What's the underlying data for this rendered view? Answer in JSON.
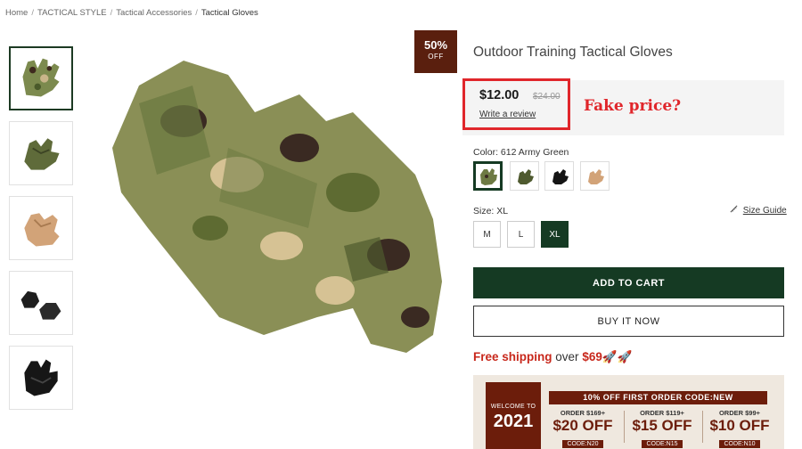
{
  "breadcrumb": [
    "Home",
    "TACTICAL STYLE",
    "Tactical Accessories",
    "Tactical Gloves"
  ],
  "breadcrumb_separator": "/",
  "product": {
    "title": "Outdoor Training Tactical Gloves",
    "sale_badge_pct": "50%",
    "sale_badge_off": "OFF",
    "price": "$12.00",
    "price_old": "$24.00",
    "write_review": "Write a review",
    "color_label": "Color: 612 Army Green",
    "size_label": "Size: XL",
    "size_guide": "Size Guide",
    "sizes": [
      "M",
      "L",
      "XL"
    ],
    "selected_size": "XL",
    "add_to_cart": "ADD TO CART",
    "buy_now": "BUY IT NOW"
  },
  "annotation": "Fake price?",
  "shipping": {
    "free": "Free shipping",
    "over": "over",
    "amount": "$69",
    "emoji": "🚀🚀"
  },
  "banner": {
    "welcome": "WELCOME TO",
    "year": "2021",
    "headline": "10% OFF FIRST ORDER CODE:NEW",
    "offers": [
      {
        "order": "ORDER $169+",
        "amount": "$20 OFF",
        "code": "CODE:N20"
      },
      {
        "order": "ORDER $119+",
        "amount": "$15 OFF",
        "code": "CODE:N15"
      },
      {
        "order": "ORDER $99+",
        "amount": "$10 OFF",
        "code": "CODE:N10"
      }
    ]
  },
  "colors": {
    "accent_green": "#153a23",
    "highlight_red": "#e0262b",
    "badge_brown": "#5a1f0e"
  }
}
